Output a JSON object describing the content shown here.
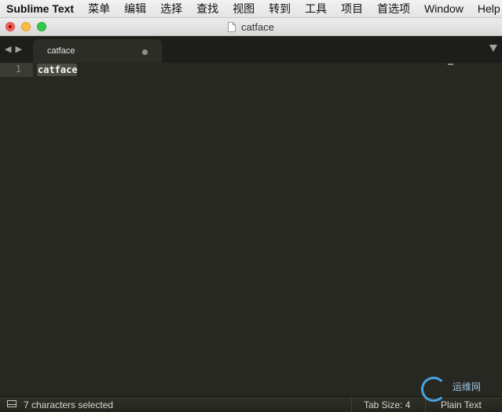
{
  "menubar": {
    "app_name": "Sublime Text",
    "items": [
      "菜单",
      "编辑",
      "选择",
      "查找",
      "视图",
      "转到",
      "工具",
      "项目",
      "首选项",
      "Window",
      "Help"
    ]
  },
  "window": {
    "title": "catface",
    "icon": "document-icon"
  },
  "tabs": [
    {
      "label": "catface",
      "modified_indicator": "dot"
    }
  ],
  "editor": {
    "line_numbers": [
      "1"
    ],
    "lines": [
      "catface"
    ],
    "selected_text": "catface"
  },
  "statusbar": {
    "selection_text": "7 characters selected",
    "tab_size": "Tab Size: 4",
    "syntax": "Plain Text"
  },
  "watermark": {
    "text": "运维网"
  },
  "colors": {
    "editor_bg": "#272822",
    "tabbar_bg": "#1d1e19",
    "text": "#f8f8f2",
    "close": "#fc605b",
    "minimize": "#fdbc40",
    "maximize": "#34c84a"
  }
}
